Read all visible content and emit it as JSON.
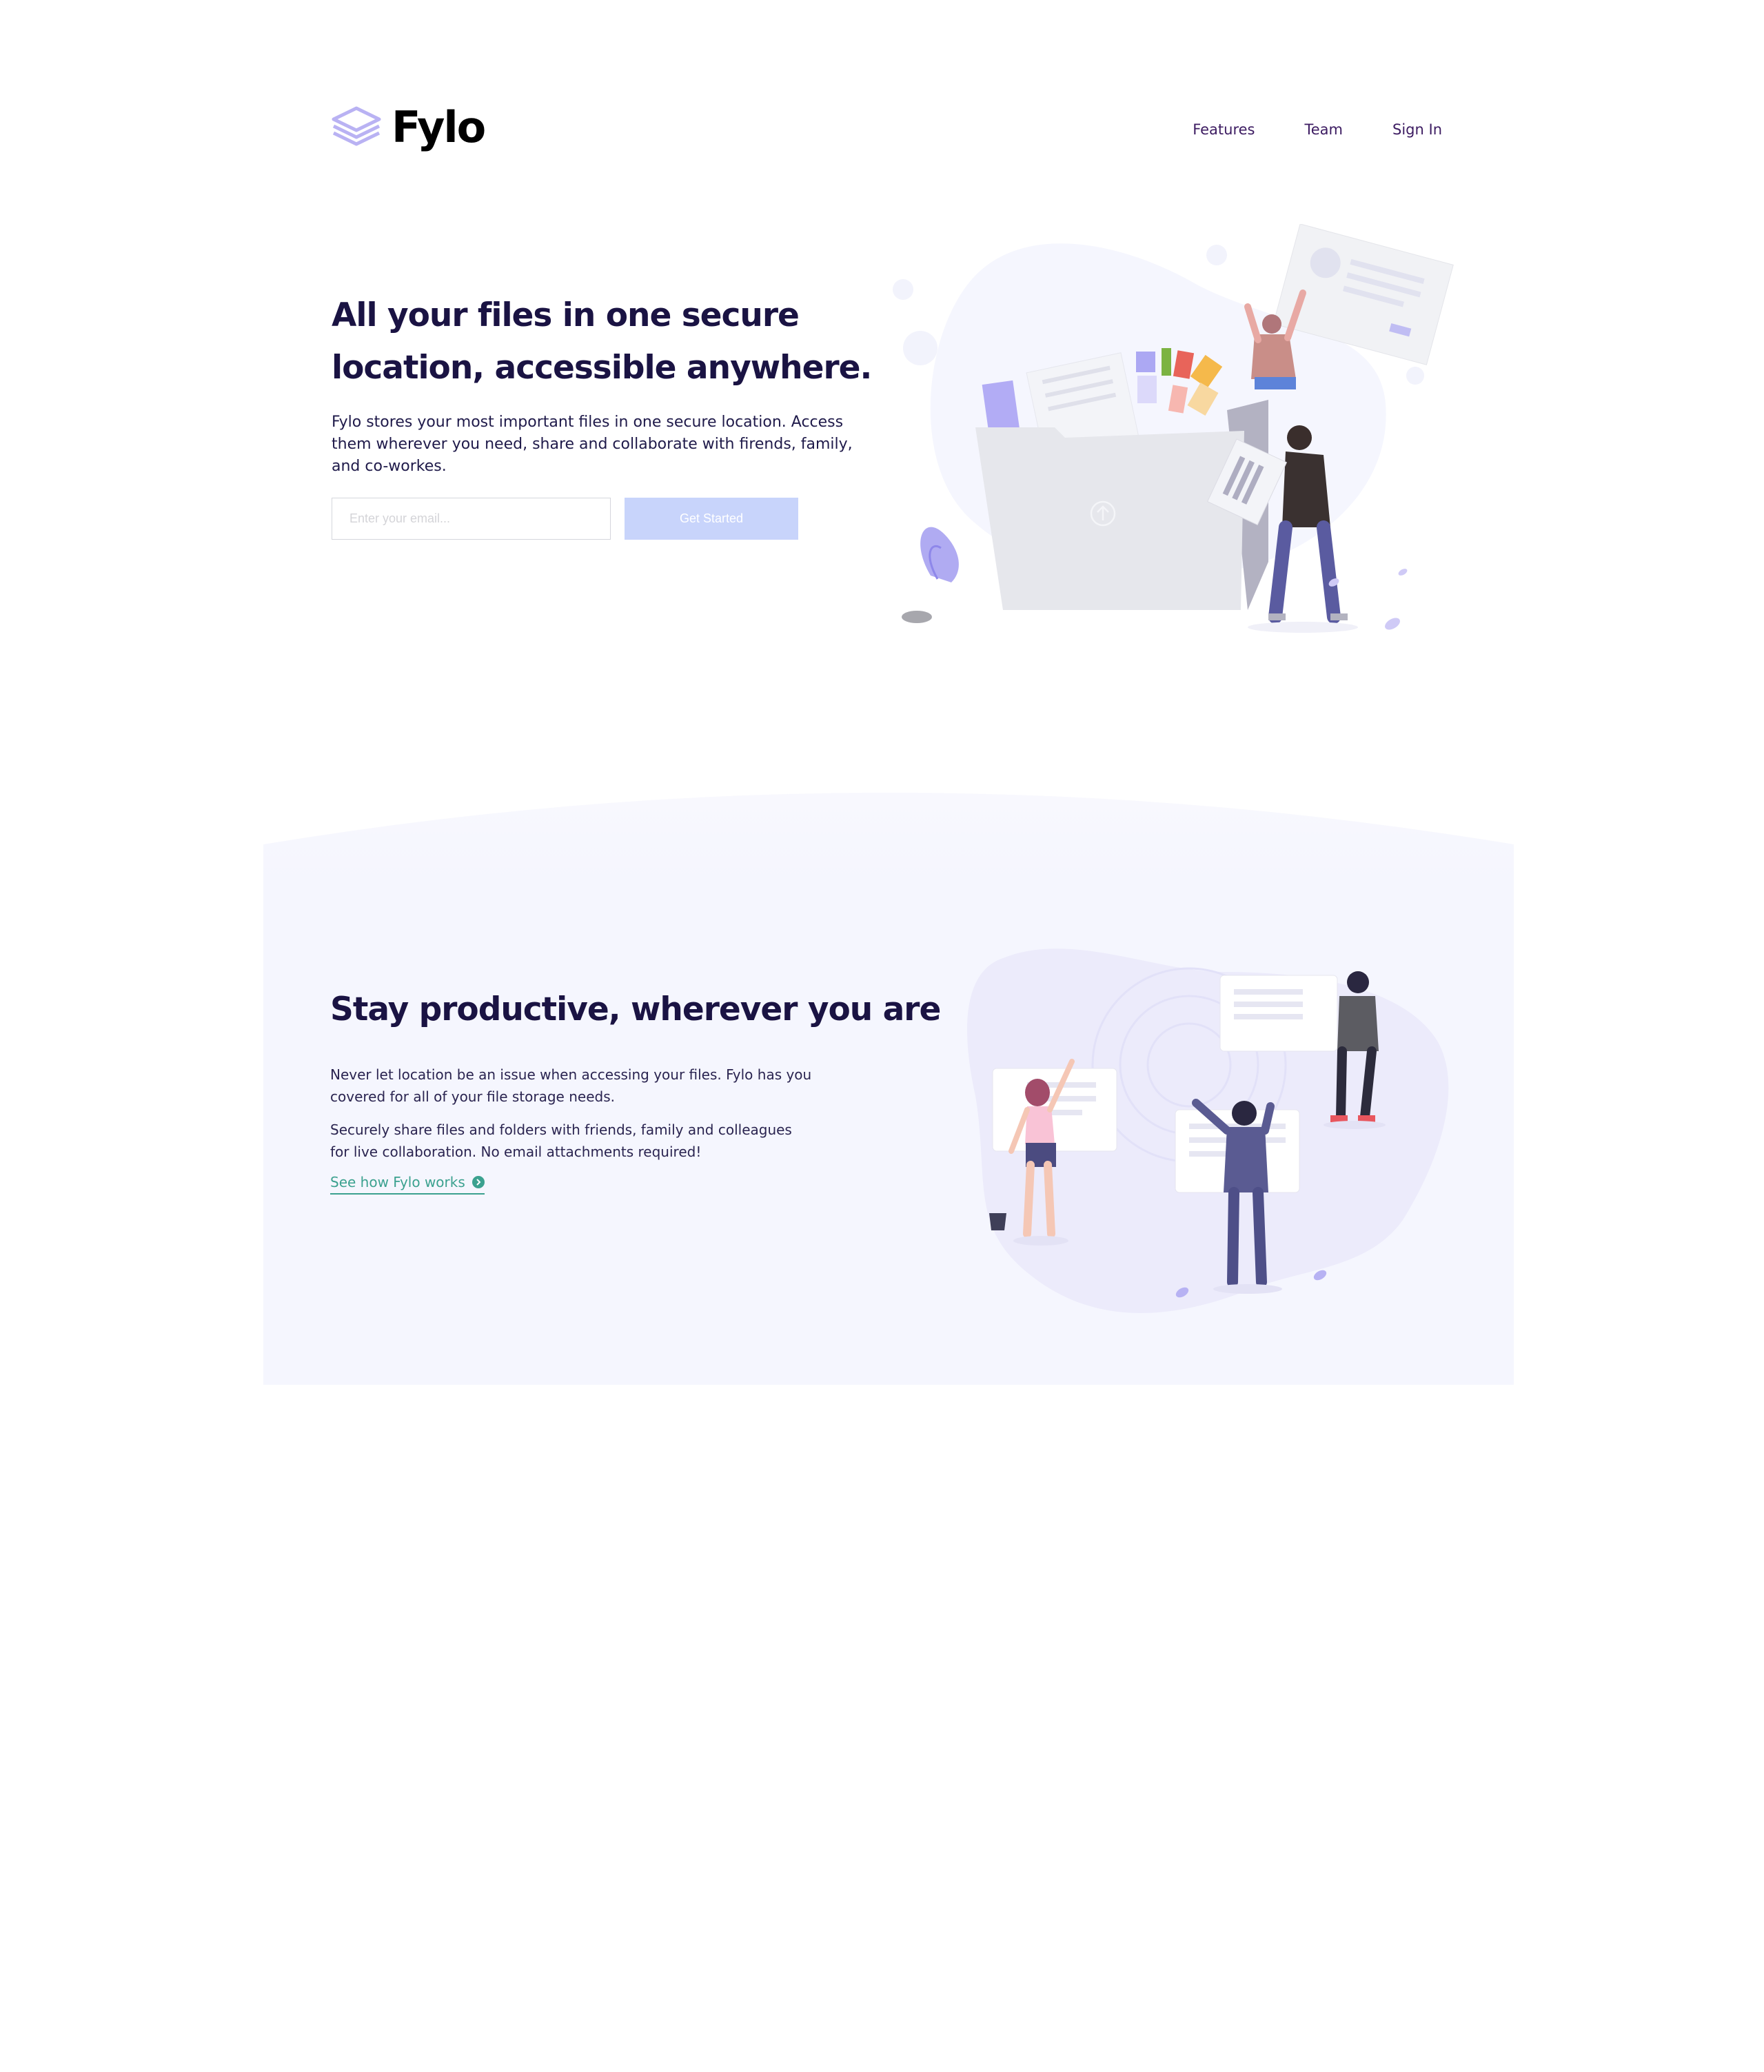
{
  "header": {
    "brand": "Fylo",
    "nav": [
      {
        "label": "Features"
      },
      {
        "label": "Team"
      },
      {
        "label": "Sign In"
      }
    ]
  },
  "hero": {
    "title": "All your files in one secure location, accessible anywhere.",
    "text": "Fylo stores your most important files in one secure location. Access them wherever you need, share and collaborate with firends, family, and co-workes.",
    "email_placeholder": "Enter your email...",
    "cta_label": "Get Started"
  },
  "productive": {
    "title": "Stay productive, wherever you are",
    "text1": "Never let location be an issue when accessing your files. Fylo has you covered for all of your file storage needs.",
    "text2": "Securely share files and folders with friends, family and colleagues for live collaboration. No email attachments required!",
    "link_label": "See how Fylo works"
  },
  "colors": {
    "accent": "#c8d4fb",
    "heading": "#1a1343",
    "link": "#3ba18f",
    "nav": "#3c1b61",
    "section_bg": "#f5f6fe"
  },
  "icons": [
    "logo-layers-icon",
    "arrow-circle-right-icon",
    "upload-icon"
  ]
}
